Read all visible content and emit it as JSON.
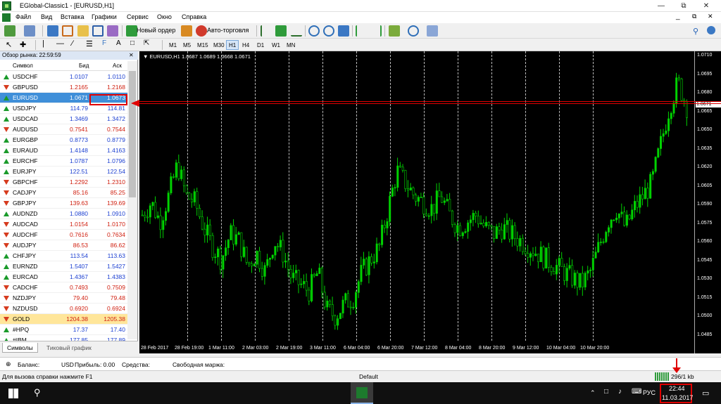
{
  "window": {
    "title": "EGlobal-Classic1 - [EURUSD,H1]",
    "minimize": "—",
    "maximize": "⧉",
    "close": "✕"
  },
  "menu": [
    "Файл",
    "Вид",
    "Вставка",
    "Графики",
    "Сервис",
    "Окно",
    "Справка"
  ],
  "toolbar": {
    "new_order": "Новый ордер",
    "autotrading": "Авто-торговля"
  },
  "timeframes": [
    "M1",
    "M5",
    "M15",
    "M30",
    "H1",
    "H4",
    "D1",
    "W1",
    "MN"
  ],
  "active_timeframe": "H1",
  "market_watch": {
    "header": "Обзор рынка: 22:59:59",
    "col_symbol": "Символ",
    "col_bid": "Бид",
    "col_ask": "Аск",
    "rows": [
      {
        "s": "USDCHF",
        "b": "1.0107",
        "a": "1.0110",
        "d": "up"
      },
      {
        "s": "GBPUSD",
        "b": "1.2165",
        "a": "1.2168",
        "d": "dn"
      },
      {
        "s": "EURUSD",
        "b": "1.0671",
        "a": "1.0673",
        "d": "up"
      },
      {
        "s": "USDJPY",
        "b": "114.79",
        "a": "114.81",
        "d": "up"
      },
      {
        "s": "USDCAD",
        "b": "1.3469",
        "a": "1.3472",
        "d": "up"
      },
      {
        "s": "AUDUSD",
        "b": "0.7541",
        "a": "0.7544",
        "d": "dn"
      },
      {
        "s": "EURGBP",
        "b": "0.8773",
        "a": "0.8779",
        "d": "up"
      },
      {
        "s": "EURAUD",
        "b": "1.4148",
        "a": "1.4163",
        "d": "up"
      },
      {
        "s": "EURCHF",
        "b": "1.0787",
        "a": "1.0796",
        "d": "up"
      },
      {
        "s": "EURJPY",
        "b": "122.51",
        "a": "122.54",
        "d": "up"
      },
      {
        "s": "GBPCHF",
        "b": "1.2292",
        "a": "1.2310",
        "d": "dn"
      },
      {
        "s": "CADJPY",
        "b": "85.16",
        "a": "85.25",
        "d": "dn"
      },
      {
        "s": "GBPJPY",
        "b": "139.63",
        "a": "139.69",
        "d": "dn"
      },
      {
        "s": "AUDNZD",
        "b": "1.0880",
        "a": "1.0910",
        "d": "up"
      },
      {
        "s": "AUDCAD",
        "b": "1.0154",
        "a": "1.0170",
        "d": "dn"
      },
      {
        "s": "AUDCHF",
        "b": "0.7616",
        "a": "0.7634",
        "d": "dn"
      },
      {
        "s": "AUDJPY",
        "b": "86.53",
        "a": "86.62",
        "d": "dn"
      },
      {
        "s": "CHFJPY",
        "b": "113.54",
        "a": "113.63",
        "d": "up"
      },
      {
        "s": "EURNZD",
        "b": "1.5407",
        "a": "1.5427",
        "d": "up"
      },
      {
        "s": "EURCAD",
        "b": "1.4367",
        "a": "1.4383",
        "d": "up"
      },
      {
        "s": "CADCHF",
        "b": "0.7493",
        "a": "0.7509",
        "d": "dn"
      },
      {
        "s": "NZDJPY",
        "b": "79.40",
        "a": "79.48",
        "d": "dn"
      },
      {
        "s": "NZDUSD",
        "b": "0.6920",
        "a": "0.6924",
        "d": "dn"
      },
      {
        "s": "GOLD",
        "b": "1204.38",
        "a": "1205.38",
        "d": "dn"
      },
      {
        "s": "#HPQ",
        "b": "17.37",
        "a": "17.40",
        "d": "up"
      },
      {
        "s": "#IBM",
        "b": "177.85",
        "a": "177.89",
        "d": "up"
      }
    ],
    "selected": "EURUSD",
    "tab_symbols": "Символы",
    "tab_tick": "Тиковый график"
  },
  "chart": {
    "title": "EURUSD,H1  1.0687 1.0689 1.0668 1.0671",
    "current_price": "1.0671",
    "price_labels": [
      "1.0710",
      "1.0695",
      "1.0680",
      "1.0665",
      "1.0650",
      "1.0635",
      "1.0620",
      "1.0605",
      "1.0590",
      "1.0575",
      "1.0560",
      "1.0545",
      "1.0530",
      "1.0515",
      "1.0500",
      "1.0485"
    ],
    "time_labels": [
      "28 Feb 2017",
      "28 Feb 19:00",
      "1 Mar 11:00",
      "2 Mar 03:00",
      "2 Mar 19:00",
      "3 Mar 11:00",
      "6 Mar 04:00",
      "6 Mar 20:00",
      "7 Mar 12:00",
      "8 Mar 04:00",
      "8 Mar 20:00",
      "9 Mar 12:00",
      "10 Mar 04:00",
      "10 Mar 20:00"
    ],
    "bull_color": "#00d200",
    "bg": "#000000"
  },
  "chart_data": {
    "type": "candlestick",
    "title": "EURUSD,H1",
    "ylim": [
      1.0485,
      1.071
    ],
    "x_range": [
      "28 Feb 2017",
      "10 Mar 20:00"
    ],
    "close_path": [
      1.0585,
      1.0595,
      1.058,
      1.06,
      1.0625,
      1.06,
      1.0595,
      1.0575,
      1.056,
      1.055,
      1.057,
      1.0565,
      1.0545,
      1.0555,
      1.054,
      1.0565,
      1.0555,
      1.0535,
      1.053,
      1.0525,
      1.054,
      1.051,
      1.0505,
      1.0515,
      1.052,
      1.054,
      1.055,
      1.056,
      1.059,
      1.062,
      1.061,
      1.06,
      1.0595,
      1.059,
      1.06,
      1.0585,
      1.0575,
      1.058,
      1.0585,
      1.0575,
      1.057,
      1.0575,
      1.057,
      1.0565,
      1.056,
      1.0555,
      1.055,
      1.0545,
      1.054,
      1.0535,
      1.053,
      1.054,
      1.056,
      1.058,
      1.059,
      1.0575,
      1.059,
      1.06,
      1.061,
      1.064,
      1.067,
      1.069,
      1.0671
    ]
  },
  "status": {
    "balance_label": "Баланс:",
    "currency": "USD",
    "profit": "Прибыль: 0.00",
    "funds": "Средства:",
    "free_margin": "Свободная маржа:",
    "help": "Для вызова справки нажмите F1",
    "profile": "Default",
    "traffic": "296/1 kb"
  },
  "taskbar": {
    "lang": "РУС",
    "time": "22:44",
    "date": "11.03.2017"
  },
  "colors": {
    "highlight": "#e00000",
    "selection": "#3f8fd9",
    "gold_row": "#ffe69a"
  }
}
